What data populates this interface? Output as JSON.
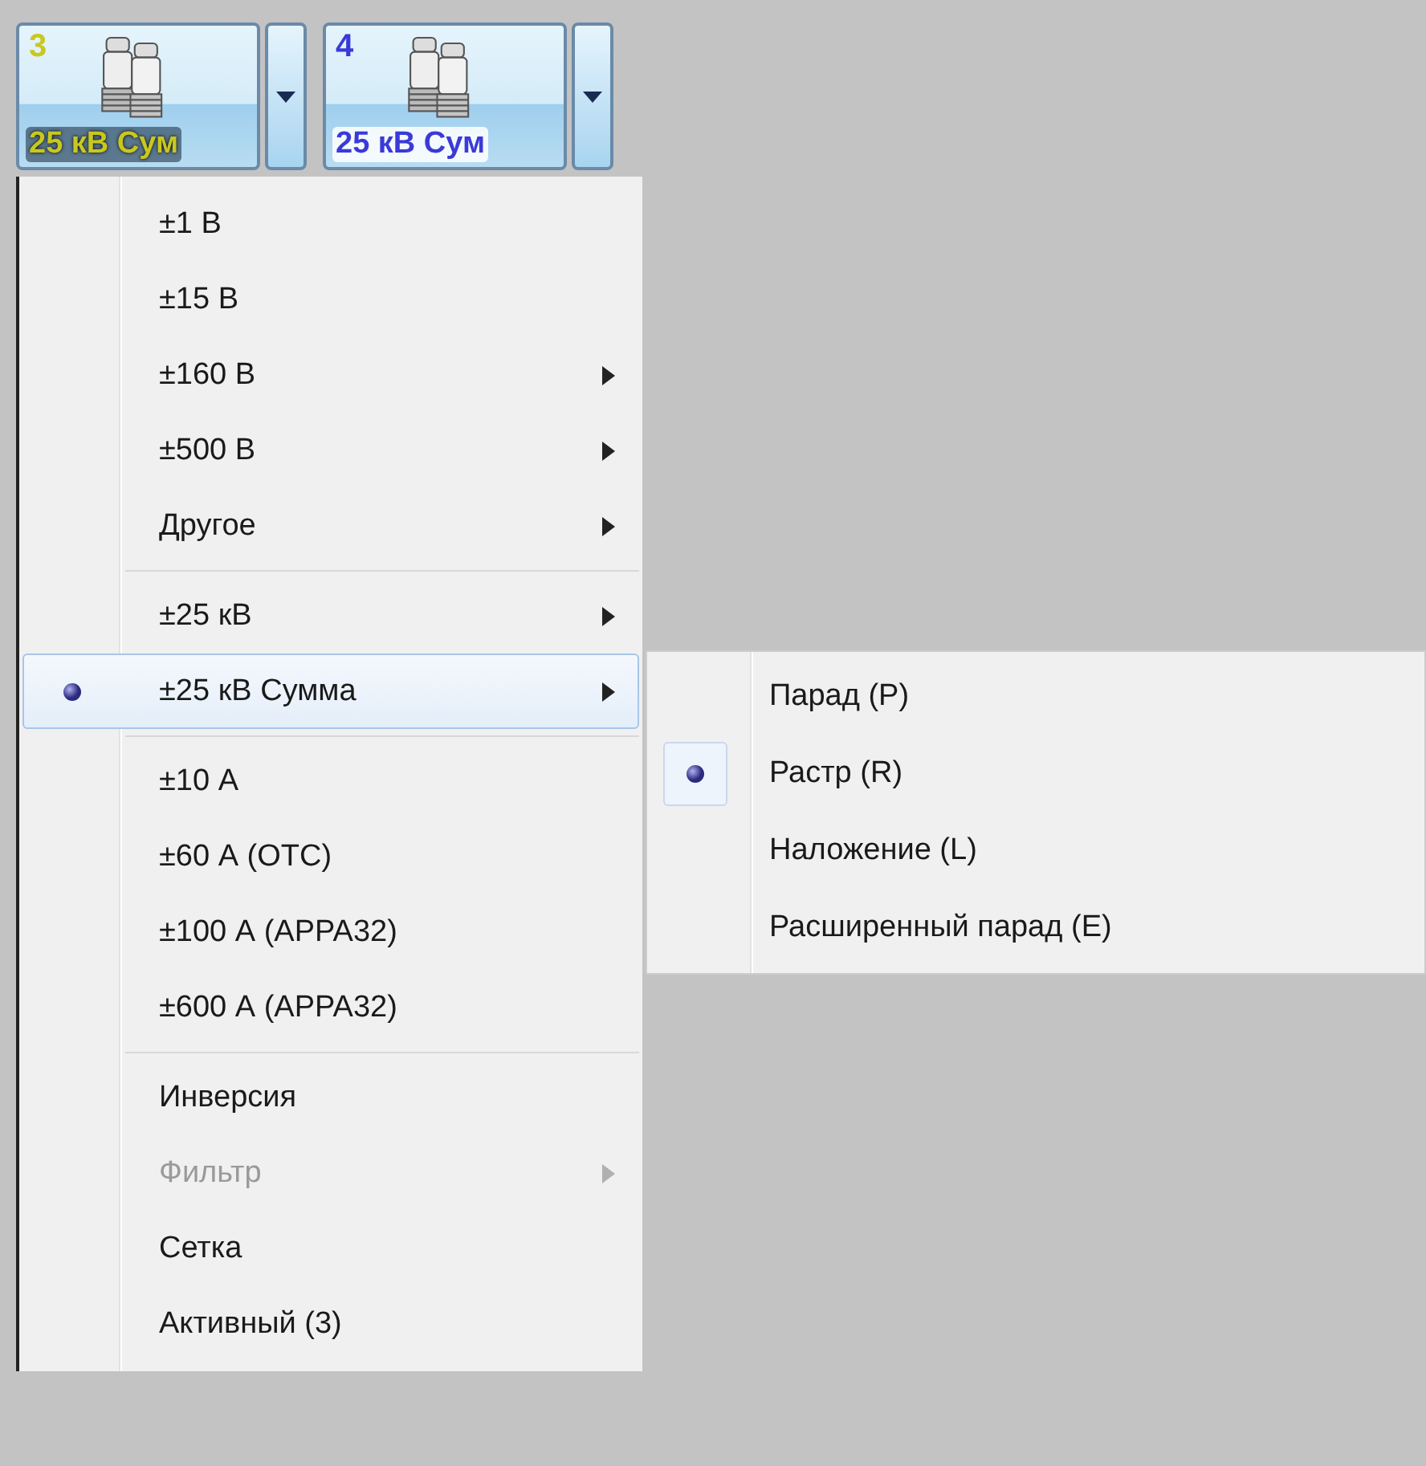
{
  "channels": [
    {
      "number": "3",
      "label": "25 кВ Сум",
      "color": "#c8c81e"
    },
    {
      "number": "4",
      "label": "25 кВ Сум",
      "color": "#3a3ad8"
    }
  ],
  "menu": {
    "items": [
      {
        "kind": "item",
        "label": "±1 В",
        "selected": false,
        "has_submenu": false,
        "disabled": false
      },
      {
        "kind": "item",
        "label": "±15 В",
        "selected": false,
        "has_submenu": false,
        "disabled": false
      },
      {
        "kind": "item",
        "label": "±160 В",
        "selected": false,
        "has_submenu": true,
        "disabled": false
      },
      {
        "kind": "item",
        "label": "±500 В",
        "selected": false,
        "has_submenu": true,
        "disabled": false
      },
      {
        "kind": "item",
        "label": "Другое",
        "selected": false,
        "has_submenu": true,
        "disabled": false
      },
      {
        "kind": "separator"
      },
      {
        "kind": "item",
        "label": "±25 кВ",
        "selected": false,
        "has_submenu": true,
        "disabled": false
      },
      {
        "kind": "item",
        "label": "±25 кВ Сумма",
        "selected": true,
        "has_submenu": true,
        "disabled": false,
        "expanded": true,
        "submenu": [
          {
            "label": "Парад (P)",
            "selected": false
          },
          {
            "label": "Растр (R)",
            "selected": true
          },
          {
            "label": "Наложение (L)",
            "selected": false
          },
          {
            "label": "Расширенный парад (E)",
            "selected": false
          }
        ]
      },
      {
        "kind": "separator"
      },
      {
        "kind": "item",
        "label": "±10 А",
        "selected": false,
        "has_submenu": false,
        "disabled": false
      },
      {
        "kind": "item",
        "label": "±60 А (OTC)",
        "selected": false,
        "has_submenu": false,
        "disabled": false
      },
      {
        "kind": "item",
        "label": "±100 А (APPA32)",
        "selected": false,
        "has_submenu": false,
        "disabled": false
      },
      {
        "kind": "item",
        "label": "±600 А (APPA32)",
        "selected": false,
        "has_submenu": false,
        "disabled": false
      },
      {
        "kind": "separator"
      },
      {
        "kind": "item",
        "label": "Инверсия",
        "selected": false,
        "has_submenu": false,
        "disabled": false
      },
      {
        "kind": "item",
        "label": "Фильтр",
        "selected": false,
        "has_submenu": true,
        "disabled": true
      },
      {
        "kind": "item",
        "label": "Сетка",
        "selected": false,
        "has_submenu": false,
        "disabled": false
      },
      {
        "kind": "item",
        "label": "Активный (3)",
        "selected": false,
        "has_submenu": false,
        "disabled": false
      }
    ]
  }
}
